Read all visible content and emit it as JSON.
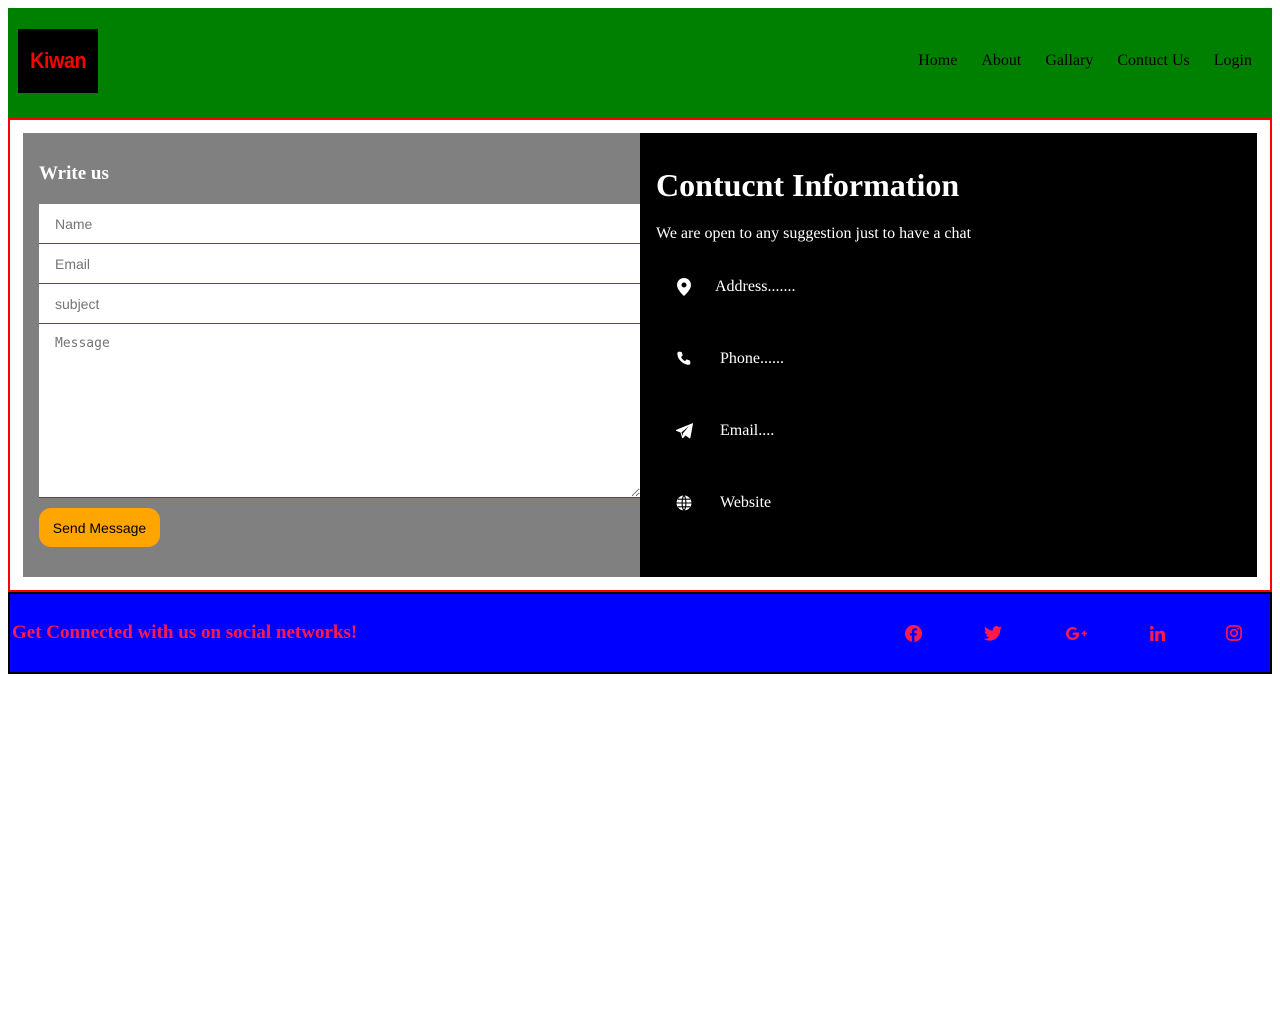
{
  "header": {
    "logo_text": "Kiwan",
    "nav": [
      "Home",
      "About",
      "Gallary",
      "Contuct Us",
      "Login"
    ]
  },
  "form": {
    "title": "Write us",
    "name_placeholder": "Name",
    "email_placeholder": "Email",
    "subject_placeholder": "subject",
    "message_placeholder": "Message",
    "send_label": "Send Message"
  },
  "info": {
    "title": "Contucnt Information",
    "subtitle": "We are open to any suggestion just to have a chat",
    "address": "Address.......",
    "phone": "Phone......",
    "email": "Email....",
    "website": "Website",
    "icons": [
      "map-pin-icon",
      "phone-icon",
      "paper-plane-icon",
      "globe-icon"
    ]
  },
  "footer": {
    "text": "Get Connected with us on social networks!",
    "social_icons": [
      "facebook-icon",
      "twitter-icon",
      "google-plus-icon",
      "linkedin-icon",
      "instagram-icon"
    ]
  },
  "colors": {
    "header_bg": "#008000",
    "logo_text": "#ff0000",
    "form_panel": "#808080",
    "info_panel": "#000000",
    "button": "#ffa500",
    "footer_bg": "#0000ff",
    "footer_text": "#ff1a4d",
    "frame_border": "#ff0000"
  }
}
